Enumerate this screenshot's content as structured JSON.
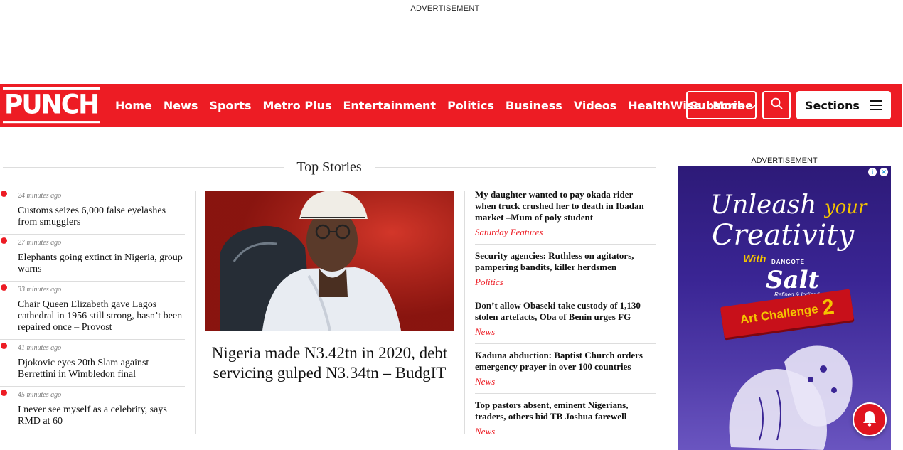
{
  "top_ad": {
    "label": "ADVERTISEMENT"
  },
  "header": {
    "logo_text": "PUNCH",
    "nav": [
      "Home",
      "News",
      "Sports",
      "Metro Plus",
      "Entertainment",
      "Politics",
      "Business",
      "Videos",
      "HealthWise"
    ],
    "more_label": "More",
    "subscribe_label": "Subscribe",
    "sections_label": "Sections",
    "brand_color": "#ed1c24"
  },
  "top_stories": {
    "heading": "Top Stories",
    "latest": [
      {
        "time": "24 minutes ago",
        "headline": "Customs seizes 6,000 false eyelashes from smugglers"
      },
      {
        "time": "27 minutes ago",
        "headline": "Elephants going extinct in Nigeria, group warns"
      },
      {
        "time": "33 minutes ago",
        "headline": "Chair Queen Elizabeth gave Lagos cathedral in 1956 still strong, hasn’t been repaired once – Provost"
      },
      {
        "time": "41 minutes ago",
        "headline": "Djokovic eyes 20th Slam against Berrettini in Wimbledon final"
      },
      {
        "time": "45 minutes ago",
        "headline": "I never see myself as a celebrity, says RMD at 60"
      }
    ],
    "feature": {
      "headline": "Nigeria made N3.42tn in 2020, debt servicing gulped N3.34tn – BudgIT"
    },
    "right": [
      {
        "headline": "My daughter wanted to pay okada rider when truck crushed her to death in Ibadan market –Mum of poly student",
        "category": "Saturday Features"
      },
      {
        "headline": "Security agencies: Ruthless on agitators, pampering bandits, killer herdsmen",
        "category": "Politics"
      },
      {
        "headline": "Don’t allow Obaseki take custody of 1,130 stolen artefacts, Oba of Benin urges FG",
        "category": "News"
      },
      {
        "headline": "Kaduna abduction: Baptist Church orders emergency prayer in over 100 countries",
        "category": "News"
      },
      {
        "headline": "Top pastors absent, eminent Nigerians, traders, others bid TB Joshua farewell",
        "category": "News"
      }
    ]
  },
  "side_ad": {
    "label": "ADVERTISEMENT",
    "line1": "Unleash",
    "line1b": "your",
    "line2": "Creativity",
    "with": "With",
    "brand": "DANGOTE",
    "product": "Salt",
    "tagline": "Refined & Iodized",
    "challenge": "Art Challenge",
    "challenge_num": "2"
  }
}
